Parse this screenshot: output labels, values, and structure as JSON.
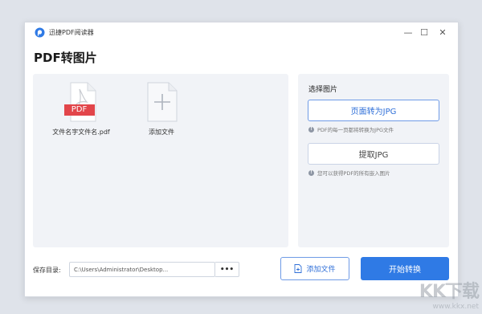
{
  "window": {
    "app_title": "迅捷PDF阅读器",
    "controls": {
      "minimize": "—",
      "maximize": "☐",
      "close": "✕"
    }
  },
  "page_title": "PDF转图片",
  "files": [
    {
      "name": "文件名字文件名.pdf",
      "badge": "PDF",
      "icon": "pdf-file-icon"
    },
    {
      "name": "添加文件",
      "icon": "add-file-icon"
    }
  ],
  "panel": {
    "title": "选择图片",
    "options": [
      {
        "label": "页面转为JPG",
        "hint": "PDF的每一页都将转换为JPG文件",
        "selected": true
      },
      {
        "label": "提取JPG",
        "hint": "您可以获得PDF的所有嵌入图片",
        "selected": false
      }
    ]
  },
  "footer": {
    "save_label": "保存目录:",
    "path_value": "C:\\Users\\Administrator\\Desktop...",
    "browse_label": "•••",
    "add_file_label": "添加文件",
    "start_label": "开始转换"
  },
  "watermark": {
    "logo": "KK下载",
    "url": "www.kkx.net"
  },
  "colors": {
    "accent": "#2f7ae5",
    "pdf_red": "#e2454a",
    "panel_bg": "#f1f3f7"
  }
}
